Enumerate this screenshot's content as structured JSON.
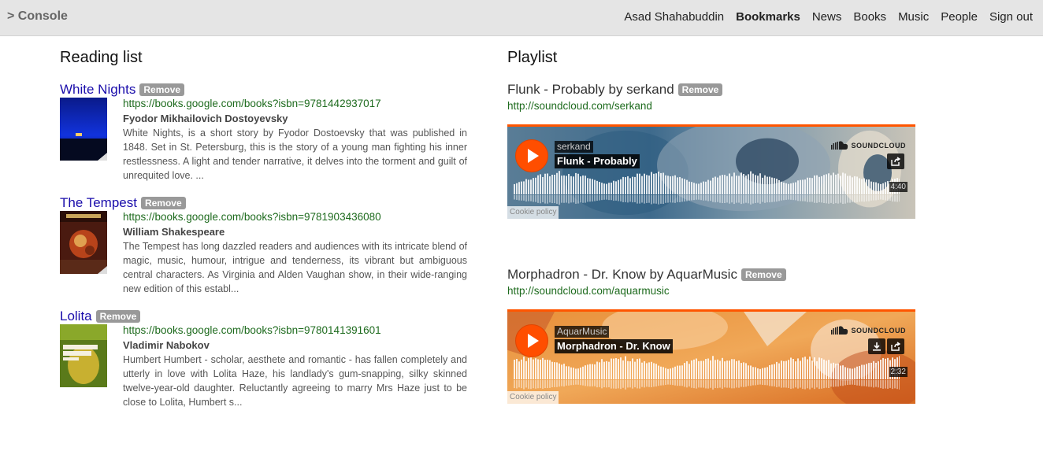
{
  "nav": {
    "brand": "> Console",
    "links": [
      "Asad Shahabuddin",
      "Bookmarks",
      "News",
      "Books",
      "Music",
      "People",
      "Sign out"
    ],
    "active": "Bookmarks"
  },
  "reading": {
    "title": "Reading list",
    "remove_label": "Remove",
    "books": [
      {
        "title": "White Nights",
        "url": "https://books.google.com/books?isbn=9781442937017",
        "author": "Fyodor Mikhailovich Dostoyevsky",
        "description": "White Nights, is a short story by Fyodor Dostoevsky that was published in 1848. Set in St. Petersburg, this is the story of a young man fighting his inner restlessness. A light and tender narrative, it delves into the torment and guilt of unrequited love. ..."
      },
      {
        "title": "The Tempest",
        "url": "https://books.google.com/books?isbn=9781903436080",
        "author": "William Shakespeare",
        "description": "The Tempest has long dazzled readers and audiences with its intricate blend of magic, music, humour, intrigue and tenderness, its vibrant but ambiguous central characters. As Virginia and Alden Vaughan show, in their wide-ranging new edition of this establ..."
      },
      {
        "title": "Lolita",
        "url": "https://books.google.com/books?isbn=9780141391601",
        "author": "Vladimir Nabokov",
        "description": "Humbert Humbert - scholar, aesthete and romantic - has fallen completely and utterly in love with Lolita Haze, his landlady's gum-snapping, silky skinned twelve-year-old daughter. Reluctantly agreeing to marry Mrs Haze just to be close to Lolita, Humbert s..."
      }
    ]
  },
  "playlist": {
    "title": "Playlist",
    "remove_label": "Remove",
    "soundcloud_label": "SOUNDCLOUD",
    "cookie_label": "Cookie policy",
    "tracks": [
      {
        "title": "Flunk - Probably by serkand",
        "url": "http://soundcloud.com/serkand",
        "artist": "serkand",
        "song": "Flunk - Probably",
        "duration": "4:40"
      },
      {
        "title": "Morphadron - Dr. Know by AquarMusic",
        "url": "http://soundcloud.com/aquarmusic",
        "artist": "AquarMusic",
        "song": "Morphadron - Dr. Know",
        "duration": "2:32"
      }
    ]
  },
  "colors": {
    "link": "#1a0dab",
    "url_green": "#1e6b1e",
    "badge": "#999999",
    "soundcloud_orange": "#ff5500"
  }
}
